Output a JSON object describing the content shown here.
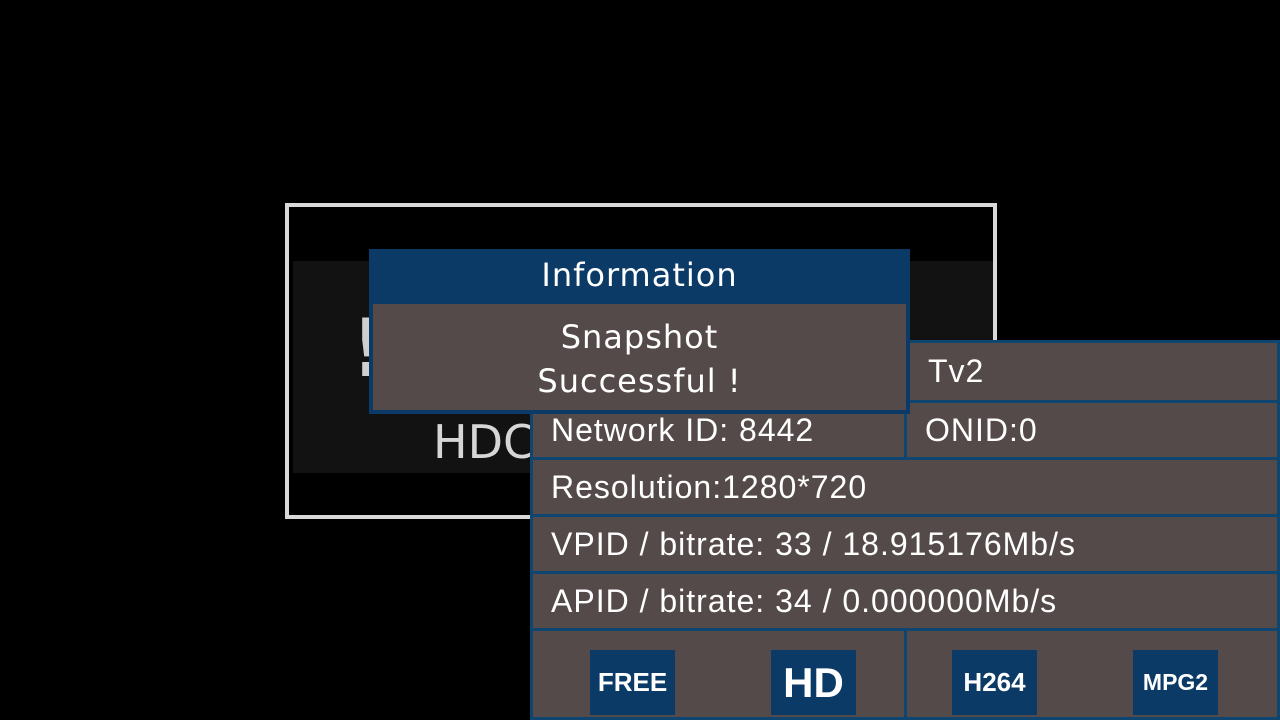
{
  "background": {
    "warning_glyph": "!",
    "hdcp_text": "HDC"
  },
  "dialog": {
    "title": "Information",
    "message_line1": "Snapshot",
    "message_line2": "Successful !"
  },
  "channel_info": {
    "channel_name": "Tv2",
    "network_id": "Network ID: 8442",
    "onid": "ONID:0",
    "resolution": "Resolution:1280*720",
    "vpid_bitrate": "VPID / bitrate: 33 / 18.915176Mb/s",
    "apid_bitrate": "APID / bitrate: 34 / 0.000000Mb/s",
    "badges": {
      "free": "FREE",
      "hd": "HD",
      "h264": "H264",
      "mpg2": "MPG2"
    }
  },
  "colors": {
    "panel_bg": "#544a49",
    "border_blue": "#0e4571",
    "badge_blue": "#0b3a66",
    "dialog_title_bg": "#0b3a66"
  }
}
